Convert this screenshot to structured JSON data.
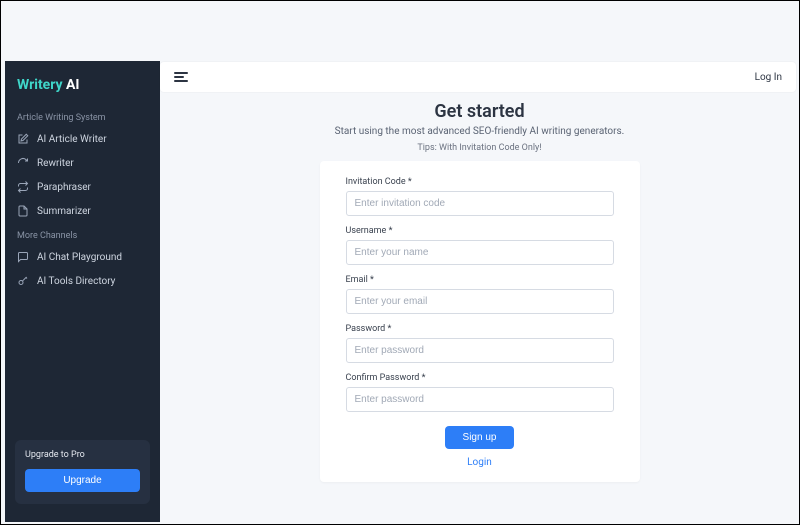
{
  "brand": {
    "part1": "Writery",
    "part2": " AI"
  },
  "sidebar": {
    "section1_label": "Article Writing System",
    "items1": [
      {
        "label": "AI Article Writer"
      },
      {
        "label": "Rewriter"
      },
      {
        "label": "Paraphraser"
      },
      {
        "label": "Summarizer"
      }
    ],
    "section2_label": "More Channels",
    "items2": [
      {
        "label": "AI Chat Playground"
      },
      {
        "label": "AI Tools Directory"
      }
    ],
    "upgrade_title": "Upgrade to Pro",
    "upgrade_button": "Upgrade"
  },
  "topbar": {
    "login": "Log In"
  },
  "signup": {
    "heading": "Get started",
    "subheading": "Start using the most advanced SEO-friendly AI writing generators.",
    "tip": "Tips: With Invitation Code Only!",
    "fields": {
      "invite_label": "Invitation Code *",
      "invite_placeholder": "Enter invitation code",
      "username_label": "Username *",
      "username_placeholder": "Enter your name",
      "email_label": "Email *",
      "email_placeholder": "Enter your email",
      "password_label": "Password *",
      "password_placeholder": "Enter password",
      "confirm_label": "Confirm Password *",
      "confirm_placeholder": "Enter password"
    },
    "submit": "Sign up",
    "login_link": "Login"
  }
}
